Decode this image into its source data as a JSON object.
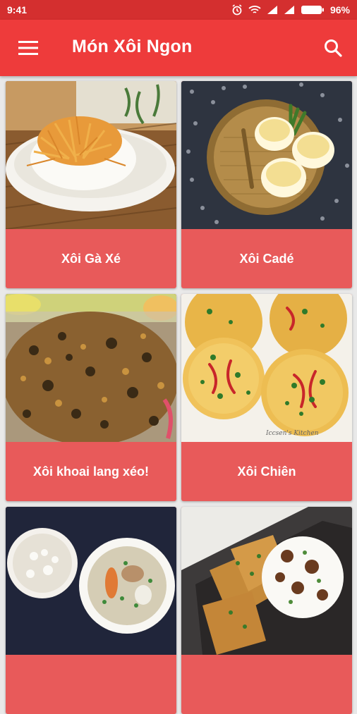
{
  "status_bar": {
    "time": "9:41",
    "battery": "96%",
    "icons": [
      "alarm-icon",
      "wifi-icon",
      "signal-icon",
      "signal-icon",
      "battery-icon"
    ]
  },
  "app_bar": {
    "title": "Món Xôi Ngon",
    "menu_icon": "hamburger-menu-icon",
    "search_icon": "search-icon"
  },
  "colors": {
    "status_bar": "#d42f2f",
    "app_bar": "#ee3b3b",
    "card_label_bg": "#e85a5a",
    "text": "#ffffff"
  },
  "recipes": [
    {
      "name": "Xôi Gà Xé"
    },
    {
      "name": "Xôi Cadé"
    },
    {
      "name": "Xôi khoai lang xéo!"
    },
    {
      "name": "Xôi Chiên"
    },
    {
      "name": "",
      "image_text": ""
    },
    {
      "name": ""
    }
  ],
  "photo_captions": {
    "chien_watermark": "Iccsen's Kitchen"
  }
}
